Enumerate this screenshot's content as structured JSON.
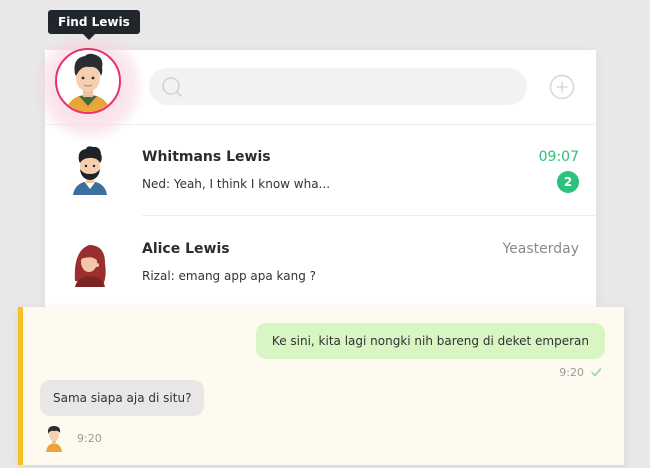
{
  "tooltip": {
    "text": "Find Lewis"
  },
  "search": {
    "placeholder": ""
  },
  "icons": {
    "search": "search-icon",
    "add": "add-icon",
    "check": "check-icon"
  },
  "colors": {
    "accent_green": "#2bbf7c",
    "avatar_ring": "#e8336b",
    "conversation_accent": "#f6c026",
    "outgoing_bubble": "#d8f5c4",
    "incoming_bubble": "#e8e7e5"
  },
  "chats": [
    {
      "name": "Whitmans Lewis",
      "preview": "Ned: Yeah, I think I know wha...",
      "time": "09:07",
      "unread": "2"
    },
    {
      "name": "Alice Lewis",
      "preview": "Rizal: emang app apa kang ?",
      "time": "Yeasterday"
    }
  ],
  "conversation": {
    "messages": [
      {
        "direction": "out",
        "text": "Ke sini, kita lagi nongki nih bareng di deket emperan",
        "time": "9:20"
      },
      {
        "direction": "in",
        "text": "Sama siapa aja di situ?",
        "time": "9:20"
      }
    ]
  }
}
